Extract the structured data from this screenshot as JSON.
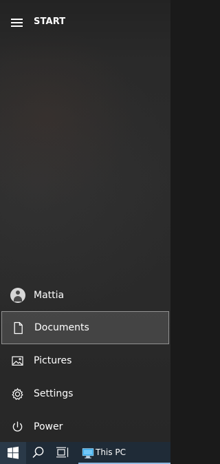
{
  "start_menu": {
    "title": "START",
    "menu_icon": "hamburger-icon",
    "items": [
      {
        "label": "Mattia",
        "icon": "user-avatar-icon",
        "active": false
      },
      {
        "label": "Documents",
        "icon": "document-icon",
        "active": true
      },
      {
        "label": "Pictures",
        "icon": "pictures-icon",
        "active": false
      },
      {
        "label": "Settings",
        "icon": "gear-icon",
        "active": false
      },
      {
        "label": "Power",
        "icon": "power-icon",
        "active": false
      }
    ]
  },
  "taskbar": {
    "start_icon": "windows-logo-icon",
    "search_icon": "search-icon",
    "task_view_icon": "task-view-icon",
    "open_app": {
      "label": "This PC",
      "icon": "this-pc-icon"
    }
  },
  "colors": {
    "start_menu_background": "#2a2a2a",
    "start_header_text": "#ffffff",
    "selected_item_background": "#3f3f3f",
    "selected_item_border": "#6a6a6a",
    "taskbar_background": "#1f2b37",
    "taskbar_active_indicator": "#8fb9df",
    "windows_logo": "#ffffff",
    "this_pc_icon_blue": "#35a7e8"
  }
}
